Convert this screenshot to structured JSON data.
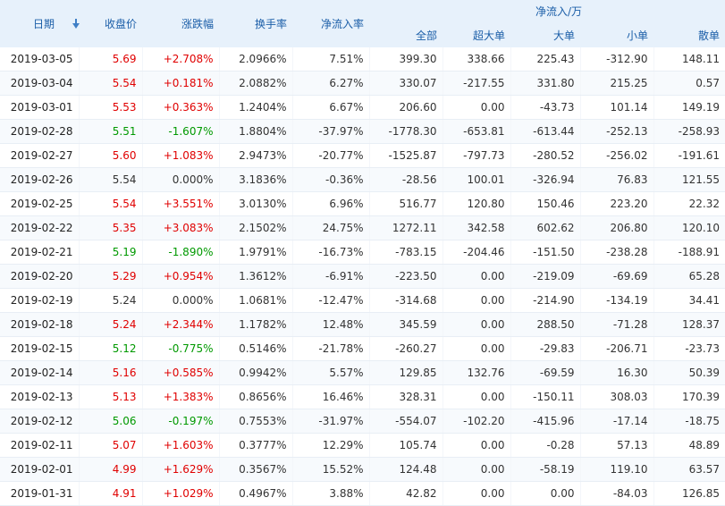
{
  "header": {
    "date": "日期",
    "close": "收盘价",
    "change": "涨跌幅",
    "turnover": "换手率",
    "net_ratio": "净流入率",
    "group": "净流入/万",
    "all": "全部",
    "super": "超大单",
    "large": "大单",
    "small": "小单",
    "retail": "散单"
  },
  "colors": {
    "up": "#e00000",
    "down": "#009900",
    "flat": "#333333",
    "header_bg": "#e7f1fb",
    "header_text": "#1b5ea8"
  },
  "rows": [
    {
      "date": "2019-03-05",
      "close": "5.69",
      "change": "+2.708%",
      "turnover": "2.0966%",
      "ratio": "7.51%",
      "all": "399.30",
      "super": "338.66",
      "large": "225.43",
      "small": "-312.90",
      "retail": "148.11",
      "trend": "up"
    },
    {
      "date": "2019-03-04",
      "close": "5.54",
      "change": "+0.181%",
      "turnover": "2.0882%",
      "ratio": "6.27%",
      "all": "330.07",
      "super": "-217.55",
      "large": "331.80",
      "small": "215.25",
      "retail": "0.57",
      "trend": "up"
    },
    {
      "date": "2019-03-01",
      "close": "5.53",
      "change": "+0.363%",
      "turnover": "1.2404%",
      "ratio": "6.67%",
      "all": "206.60",
      "super": "0.00",
      "large": "-43.73",
      "small": "101.14",
      "retail": "149.19",
      "trend": "up"
    },
    {
      "date": "2019-02-28",
      "close": "5.51",
      "change": "-1.607%",
      "turnover": "1.8804%",
      "ratio": "-37.97%",
      "all": "-1778.30",
      "super": "-653.81",
      "large": "-613.44",
      "small": "-252.13",
      "retail": "-258.93",
      "trend": "down"
    },
    {
      "date": "2019-02-27",
      "close": "5.60",
      "change": "+1.083%",
      "turnover": "2.9473%",
      "ratio": "-20.77%",
      "all": "-1525.87",
      "super": "-797.73",
      "large": "-280.52",
      "small": "-256.02",
      "retail": "-191.61",
      "trend": "up"
    },
    {
      "date": "2019-02-26",
      "close": "5.54",
      "change": "0.000%",
      "turnover": "3.1836%",
      "ratio": "-0.36%",
      "all": "-28.56",
      "super": "100.01",
      "large": "-326.94",
      "small": "76.83",
      "retail": "121.55",
      "trend": "flat"
    },
    {
      "date": "2019-02-25",
      "close": "5.54",
      "change": "+3.551%",
      "turnover": "3.0130%",
      "ratio": "6.96%",
      "all": "516.77",
      "super": "120.80",
      "large": "150.46",
      "small": "223.20",
      "retail": "22.32",
      "trend": "up"
    },
    {
      "date": "2019-02-22",
      "close": "5.35",
      "change": "+3.083%",
      "turnover": "2.1502%",
      "ratio": "24.75%",
      "all": "1272.11",
      "super": "342.58",
      "large": "602.62",
      "small": "206.80",
      "retail": "120.10",
      "trend": "up"
    },
    {
      "date": "2019-02-21",
      "close": "5.19",
      "change": "-1.890%",
      "turnover": "1.9791%",
      "ratio": "-16.73%",
      "all": "-783.15",
      "super": "-204.46",
      "large": "-151.50",
      "small": "-238.28",
      "retail": "-188.91",
      "trend": "down"
    },
    {
      "date": "2019-02-20",
      "close": "5.29",
      "change": "+0.954%",
      "turnover": "1.3612%",
      "ratio": "-6.91%",
      "all": "-223.50",
      "super": "0.00",
      "large": "-219.09",
      "small": "-69.69",
      "retail": "65.28",
      "trend": "up"
    },
    {
      "date": "2019-02-19",
      "close": "5.24",
      "change": "0.000%",
      "turnover": "1.0681%",
      "ratio": "-12.47%",
      "all": "-314.68",
      "super": "0.00",
      "large": "-214.90",
      "small": "-134.19",
      "retail": "34.41",
      "trend": "flat"
    },
    {
      "date": "2019-02-18",
      "close": "5.24",
      "change": "+2.344%",
      "turnover": "1.1782%",
      "ratio": "12.48%",
      "all": "345.59",
      "super": "0.00",
      "large": "288.50",
      "small": "-71.28",
      "retail": "128.37",
      "trend": "up"
    },
    {
      "date": "2019-02-15",
      "close": "5.12",
      "change": "-0.775%",
      "turnover": "0.5146%",
      "ratio": "-21.78%",
      "all": "-260.27",
      "super": "0.00",
      "large": "-29.83",
      "small": "-206.71",
      "retail": "-23.73",
      "trend": "down"
    },
    {
      "date": "2019-02-14",
      "close": "5.16",
      "change": "+0.585%",
      "turnover": "0.9942%",
      "ratio": "5.57%",
      "all": "129.85",
      "super": "132.76",
      "large": "-69.59",
      "small": "16.30",
      "retail": "50.39",
      "trend": "up"
    },
    {
      "date": "2019-02-13",
      "close": "5.13",
      "change": "+1.383%",
      "turnover": "0.8656%",
      "ratio": "16.46%",
      "all": "328.31",
      "super": "0.00",
      "large": "-150.11",
      "small": "308.03",
      "retail": "170.39",
      "trend": "up"
    },
    {
      "date": "2019-02-12",
      "close": "5.06",
      "change": "-0.197%",
      "turnover": "0.7553%",
      "ratio": "-31.97%",
      "all": "-554.07",
      "super": "-102.20",
      "large": "-415.96",
      "small": "-17.14",
      "retail": "-18.75",
      "trend": "down"
    },
    {
      "date": "2019-02-11",
      "close": "5.07",
      "change": "+1.603%",
      "turnover": "0.3777%",
      "ratio": "12.29%",
      "all": "105.74",
      "super": "0.00",
      "large": "-0.28",
      "small": "57.13",
      "retail": "48.89",
      "trend": "up"
    },
    {
      "date": "2019-02-01",
      "close": "4.99",
      "change": "+1.629%",
      "turnover": "0.3567%",
      "ratio": "15.52%",
      "all": "124.48",
      "super": "0.00",
      "large": "-58.19",
      "small": "119.10",
      "retail": "63.57",
      "trend": "up"
    },
    {
      "date": "2019-01-31",
      "close": "4.91",
      "change": "+1.029%",
      "turnover": "0.4967%",
      "ratio": "3.88%",
      "all": "42.82",
      "super": "0.00",
      "large": "0.00",
      "small": "-84.03",
      "retail": "126.85",
      "trend": "up"
    }
  ]
}
